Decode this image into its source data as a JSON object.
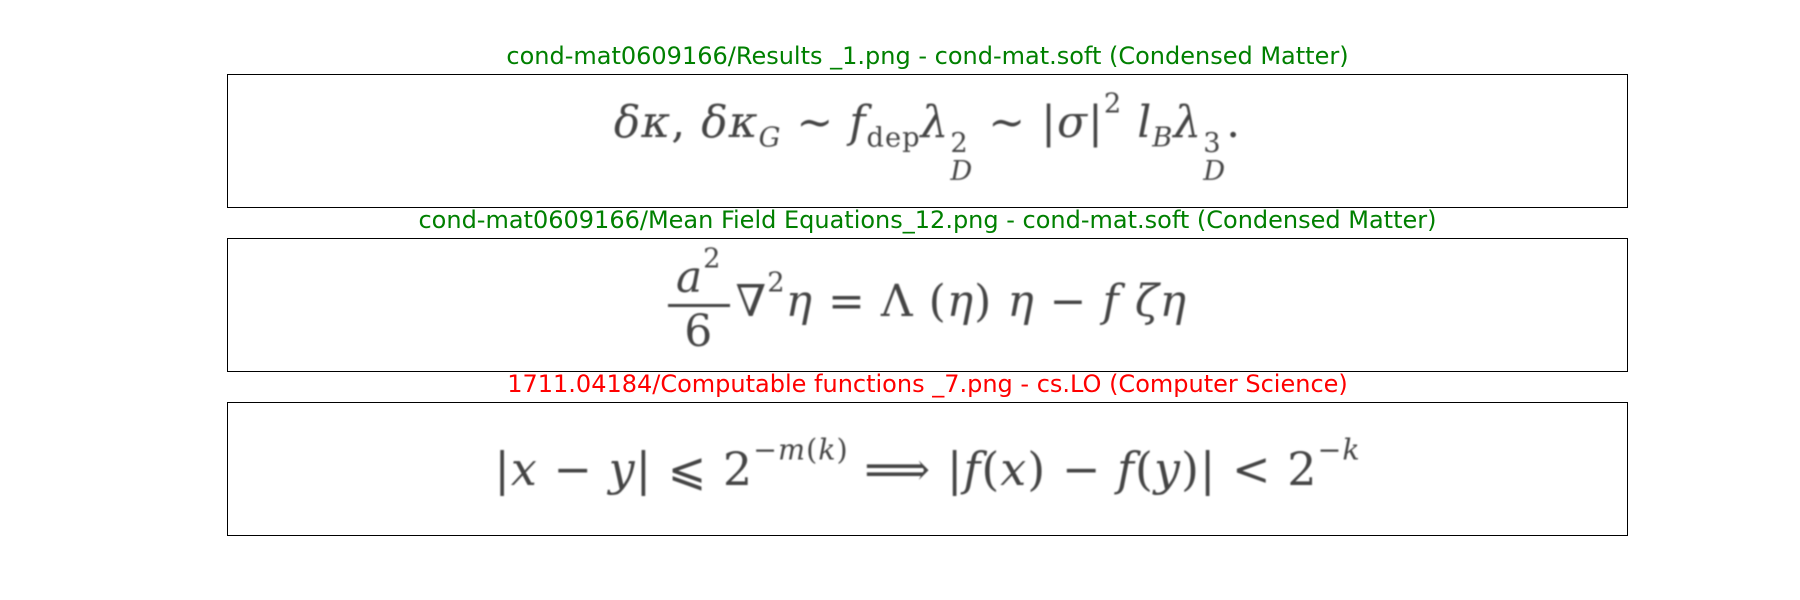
{
  "panels": [
    {
      "title": "cond-mat0609166/Results _1.png - cond-mat.soft (Condensed Matter)",
      "title_color": "#008000",
      "formula": "δκ, δκ_G ∼ f_dep λ_D^2 ∼ |σ|^2 l_B λ_D^3."
    },
    {
      "title": "cond-mat0609166/Mean Field Equations_12.png - cond-mat.soft (Condensed Matter)",
      "title_color": "#008000",
      "formula": "a^2/6 ∇^2 η = Λ(η) η − f ζ η"
    },
    {
      "title": "1711.04184/Computable functions _7.png - cs.LO (Computer Science)",
      "title_color": "#ff0000",
      "formula": "|x − y| ⩽ 2^{−m(k)} ⟹ |f(x) − f(y)| < 2^{−k}"
    }
  ]
}
